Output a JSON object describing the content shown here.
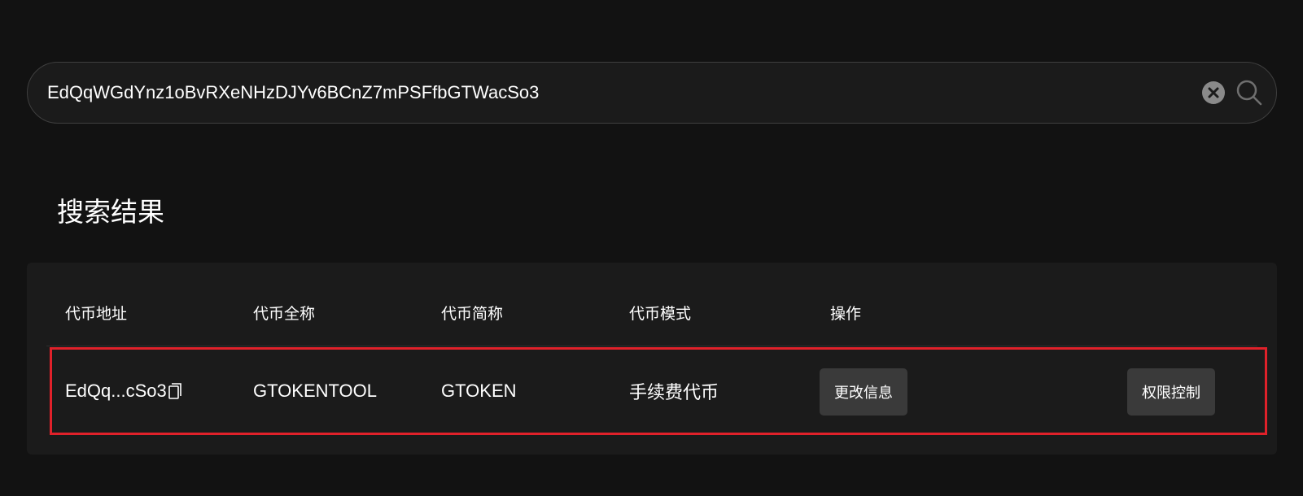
{
  "search": {
    "value": "EdQqWGdYnz1oBvRXeNHzDJYv6BCnZ7mPSFfbGTWacSo3",
    "clear_icon": "close-circle-icon",
    "search_icon": "search-icon"
  },
  "results": {
    "title": "搜索结果",
    "columns": [
      "代币地址",
      "代币全称",
      "代币简称",
      "代币模式",
      "操作"
    ],
    "rows": [
      {
        "address_short": "EdQq...cSo3",
        "copy_icon": "copy-icon",
        "full_name": "GTOKENTOOL",
        "short_name": "GTOKEN",
        "mode": "手续费代币",
        "action_edit": "更改信息",
        "action_permissions": "权限控制"
      }
    ]
  },
  "colors": {
    "background": "#121212",
    "card": "#1b1b1b",
    "highlight_border": "#e0212a",
    "button": "#3a3a3a"
  }
}
